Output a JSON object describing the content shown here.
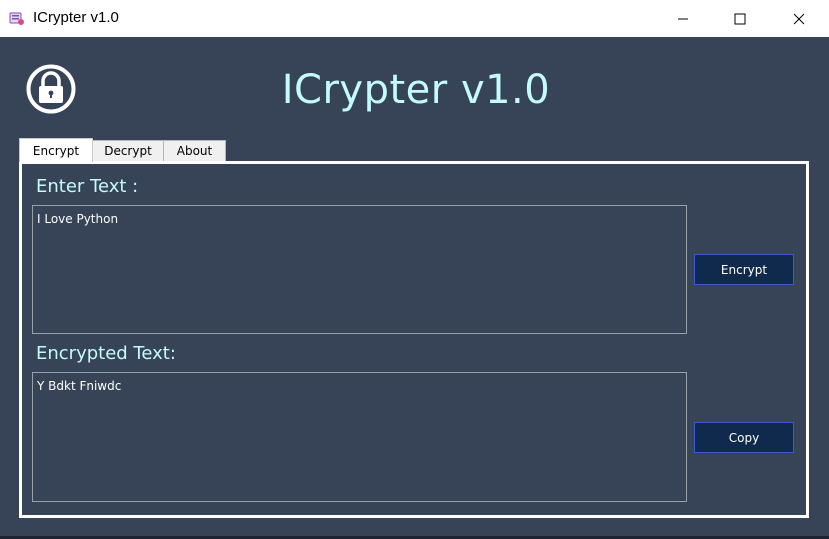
{
  "window": {
    "title": "ICrypter v1.0",
    "icons": {
      "app": "app-icon",
      "minimize": "minimize-icon",
      "maximize": "maximize-icon",
      "close": "close-icon"
    }
  },
  "header": {
    "title": "ICrypter v1.0",
    "logo_icon": "padlock-icon"
  },
  "tabs": [
    {
      "label": "Encrypt",
      "active": true
    },
    {
      "label": "Decrypt",
      "active": false
    },
    {
      "label": "About",
      "active": false
    }
  ],
  "encrypt_panel": {
    "input_label": "Enter Text :",
    "input_value": "I Love Python",
    "output_label": "Encrypted Text:",
    "output_value": "Y Bdkt Fniwdc",
    "encrypt_button": "Encrypt",
    "copy_button": "Copy"
  },
  "colors": {
    "background": "#374357",
    "heading": "#c4fbfc",
    "button": "#0f2a4d",
    "button_border": "#3a5ad0",
    "panel_border": "#ffffff"
  }
}
